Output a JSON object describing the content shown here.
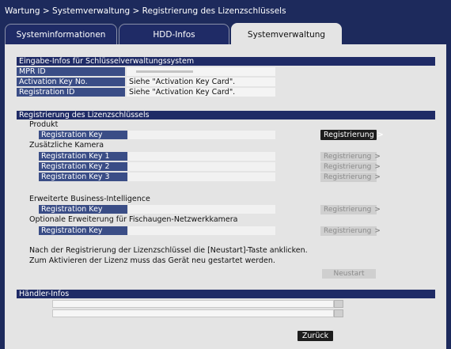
{
  "breadcrumb": "Wartung > Systemverwaltung > Registrierung des Lizenzschlüssels",
  "tabs": [
    {
      "label": "Systeminformationen",
      "active": false
    },
    {
      "label": "HDD-Infos",
      "active": false
    },
    {
      "label": "Systemverwaltung",
      "active": true
    }
  ],
  "section_key_mgmt": {
    "header": "Eingabe-Infos für Schlüsselverwaltungssystem",
    "rows": [
      {
        "label": "MPR ID",
        "value": ""
      },
      {
        "label": "Activation Key No.",
        "value": "Siehe \"Activation Key Card\"."
      },
      {
        "label": "Registration ID",
        "value": "Siehe \"Activation Key Card\"."
      }
    ]
  },
  "section_license": {
    "header": "Registrierung des Lizenzschlüssels",
    "product_title": "Produkt",
    "product_key_label": "Registration Key",
    "register_label": "Registrierung",
    "extra_camera_title": "Zusätzliche Kamera",
    "extra_camera_keys": [
      "Registration Key 1",
      "Registration Key 2",
      "Registration Key 3"
    ],
    "bi_title": "Erweiterte Business-Intelligence",
    "bi_key_label": "Registration Key",
    "fisheye_title": "Optionale Erweiterung für Fischaugen-Netzwerkkamera",
    "fisheye_key_label": "Registration Key",
    "note_line1": "Nach der Registrierung der Lizenzschlüssel die [Neustart]-Taste anklicken.",
    "note_line2": "Zum Aktivieren der Lizenz muss das Gerät neu gestartet werden.",
    "restart_label": "Neustart"
  },
  "section_dealer": {
    "header": "Händler-Infos"
  },
  "back_label": "Zurück"
}
